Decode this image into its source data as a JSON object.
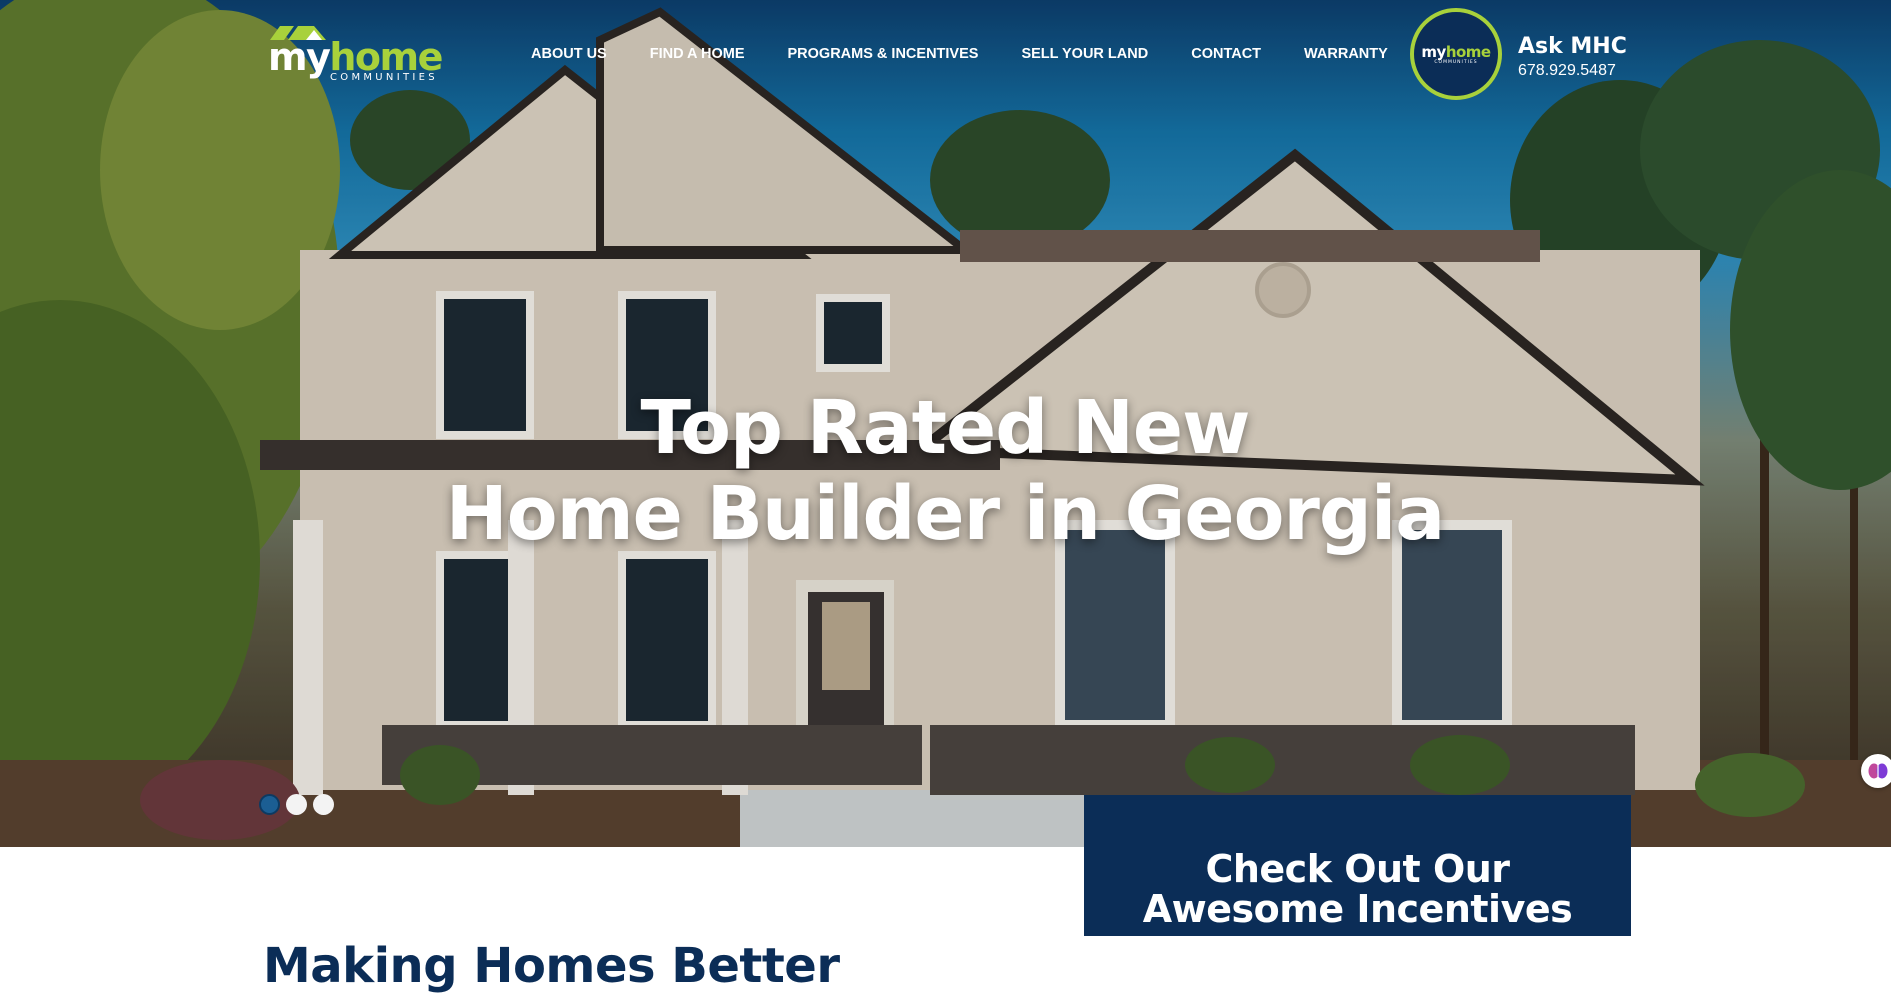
{
  "brand": {
    "logo_word_my": "my",
    "logo_word_home": "home",
    "logo_sub": "COMMUNITIES",
    "accent_green": "#a8d13b",
    "navy": "#0b2d57"
  },
  "nav": {
    "items": [
      {
        "label": "ABOUT US"
      },
      {
        "label": "FIND A HOME"
      },
      {
        "label": "PROGRAMS & INCENTIVES"
      },
      {
        "label": "SELL YOUR LAND"
      },
      {
        "label": "CONTACT"
      },
      {
        "label": "WARRANTY"
      }
    ]
  },
  "ask": {
    "badge_word_my": "my",
    "badge_word_home": "home",
    "badge_sub": "COMMUNITIES",
    "title": "Ask MHC",
    "phone": "678.929.5487"
  },
  "hero": {
    "title_line1": "Top Rated New",
    "title_line2": "Home Builder in Georgia",
    "slide_count": 3,
    "active_slide": 1
  },
  "incentives": {
    "title_line1": "Check Out Our",
    "title_line2": "Awesome Incentives"
  },
  "intro": {
    "title": "Making Homes Better"
  }
}
